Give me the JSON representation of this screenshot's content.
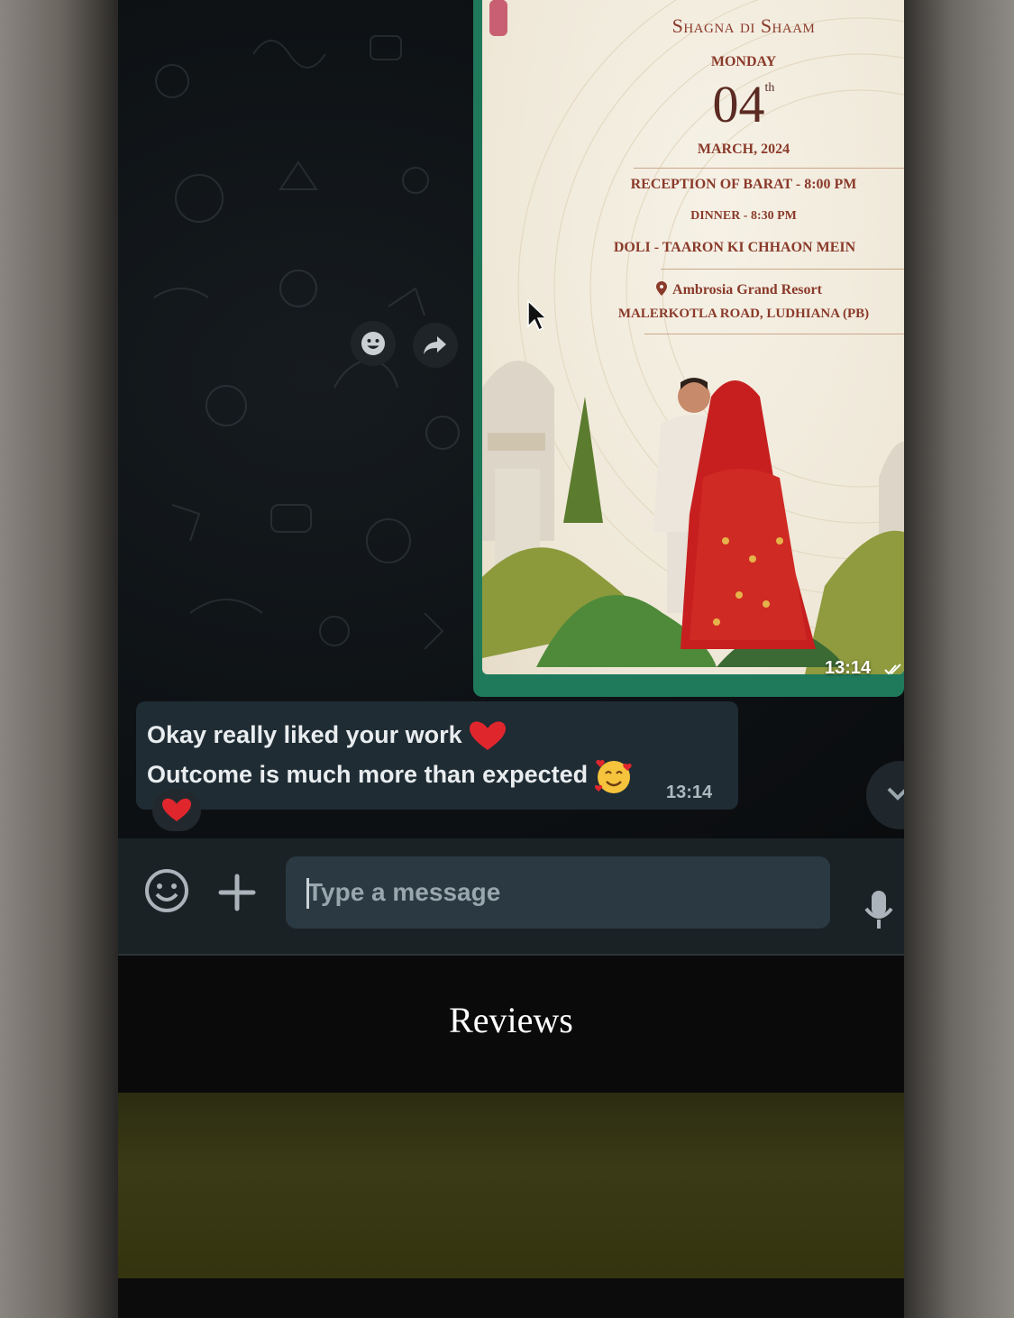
{
  "invitation": {
    "title": "Shagna di Shaam",
    "day": "MONDAY",
    "date_number": "04",
    "date_suffix": "th",
    "month_year": "MARCH, 2024",
    "line1": "RECEPTION OF BARAT - 8:00 PM",
    "line2": "DINNER - 8:30 PM",
    "line3": "DOLI - TAARON KI CHHAON MEIN",
    "venue": "Ambrosia Grand Resort",
    "address": "MALERKOTLA ROAD, LUDHIANA (PB)"
  },
  "image_message": {
    "time": "13:14"
  },
  "text_message": {
    "line1": "Okay really liked your work",
    "line2": "Outcome is much more than expected",
    "time": "13:14",
    "reaction": "heart"
  },
  "composer": {
    "placeholder": "Type a message"
  },
  "caption": "Reviews",
  "colors": {
    "chat_background": "#0e1215",
    "incoming_bubble": "#1f2c34",
    "image_bubble_border": "#1f7a5c",
    "composer_bar": "#1b2226",
    "input_field": "#2a3942",
    "invitation_text": "#8a3a2a"
  },
  "icons": [
    "emoji-reaction-icon",
    "forward-icon",
    "cursor-icon",
    "double-check-icon",
    "heart-icon",
    "smiling-hearts-emoji-icon",
    "chevron-down-icon",
    "emoji-icon",
    "plus-icon",
    "mic-icon",
    "location-pin-icon"
  ]
}
